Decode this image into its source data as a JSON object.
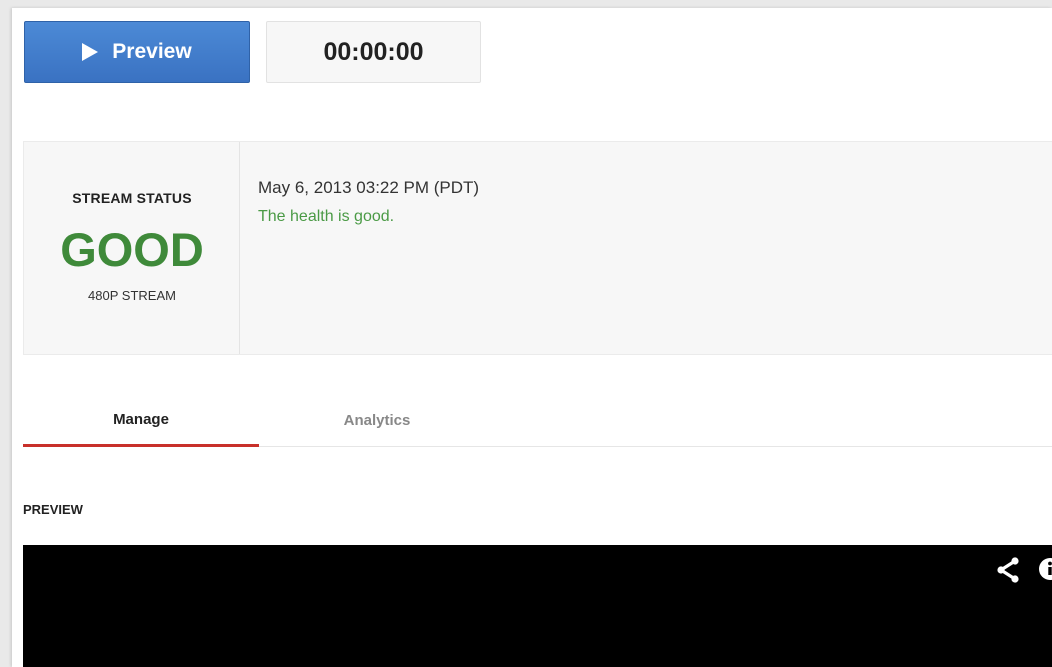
{
  "toolbar": {
    "preview_label": "Preview",
    "timer": "00:00:00"
  },
  "stream_status": {
    "label": "STREAM STATUS",
    "value": "GOOD",
    "quality": "480P STREAM",
    "timestamp": "May 6, 2013 03:22 PM (PDT)",
    "health_message": "The health is good."
  },
  "tabs": [
    {
      "label": "Manage",
      "active": true
    },
    {
      "label": "Analytics",
      "active": false
    }
  ],
  "preview_section": {
    "label": "PREVIEW"
  },
  "player_controls": [
    {
      "icon": "share-icon"
    },
    {
      "icon": "info-icon"
    }
  ],
  "colors": {
    "primary_button": "#3a72c2",
    "good_status": "#3f8a3a",
    "health_text": "#4a9a45",
    "active_tab_indicator": "#c8302a",
    "player_background": "#000000"
  }
}
